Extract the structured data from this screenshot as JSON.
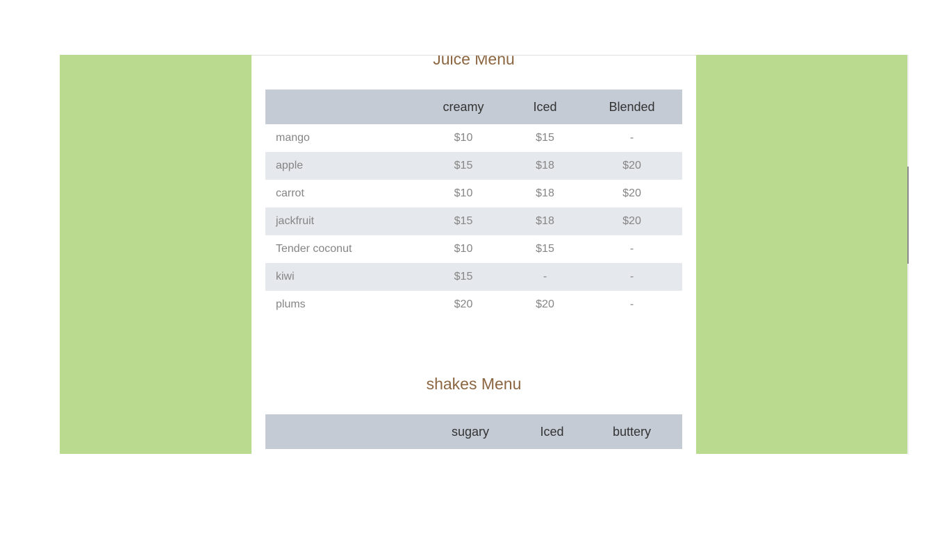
{
  "juice_menu": {
    "title": "Juice Menu",
    "columns": [
      "",
      "creamy",
      "Iced",
      "Blended"
    ],
    "rows": [
      [
        "mango",
        "$10",
        "$15",
        "-"
      ],
      [
        "apple",
        "$15",
        "$18",
        "$20"
      ],
      [
        "carrot",
        "$10",
        "$18",
        "$20"
      ],
      [
        "jackfruit",
        "$15",
        "$18",
        "$20"
      ],
      [
        "Tender coconut",
        "$10",
        "$15",
        "-"
      ],
      [
        "kiwi",
        "$15",
        "-",
        "-"
      ],
      [
        "plums",
        "$20",
        "$20",
        "-"
      ]
    ]
  },
  "shakes_menu": {
    "title": "shakes Menu",
    "columns": [
      "",
      "sugary",
      "Iced",
      "buttery"
    ]
  },
  "colors": {
    "side_panel": "#b9da8f",
    "title": "#8b6641",
    "header_bg": "#c4cbd5",
    "alt_row_bg": "#e5e8ec"
  }
}
